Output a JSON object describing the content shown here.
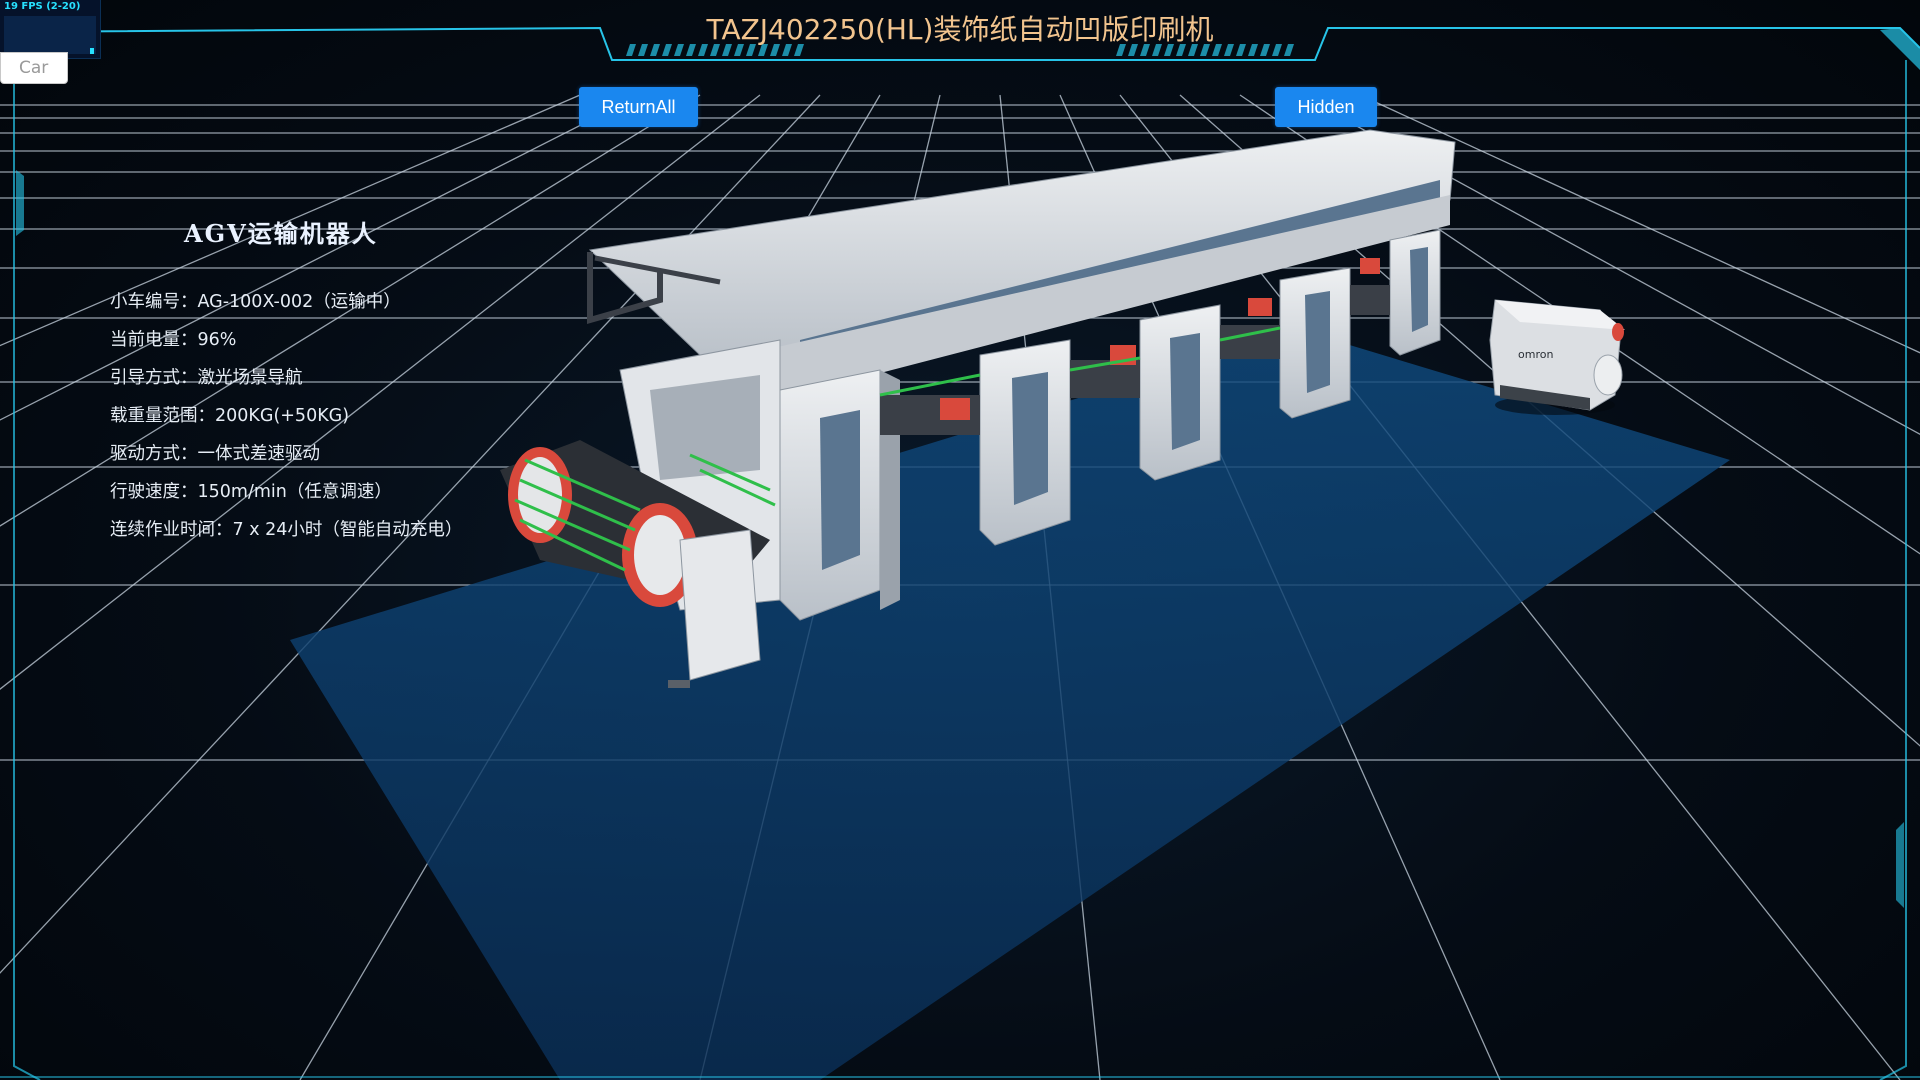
{
  "fps_monitor": {
    "text": "19 FPS (2-20)"
  },
  "car_select": {
    "value": "Car"
  },
  "header": {
    "title": "TAZJ402250(HL)装饰纸自动凹版印刷机"
  },
  "toolbar": {
    "return_all_label": "ReturnAll",
    "hidden_label": "Hidden"
  },
  "agv_info": {
    "title": "AGV运输机器人",
    "rows": [
      "小车编号：AG-100X-002（运输中）",
      "当前电量：96%",
      "引导方式：激光场景导航",
      "载重量范围：200KG(+50KG)",
      "驱动方式：一体式差速驱动",
      "行驶速度：150m/min（任意调速）",
      "连续作业时间：7 x 24小时（智能自动充电）"
    ]
  },
  "scene": {
    "agv_brand": "omron",
    "colors": {
      "grid": "#c8d4e0",
      "floor": "#0c3763",
      "frame": "#27c4e8",
      "machine_body": "#d9dde2",
      "machine_accent": "#56708a",
      "roller_red": "#d9493c",
      "roller_green": "#2fbf4a"
    }
  }
}
